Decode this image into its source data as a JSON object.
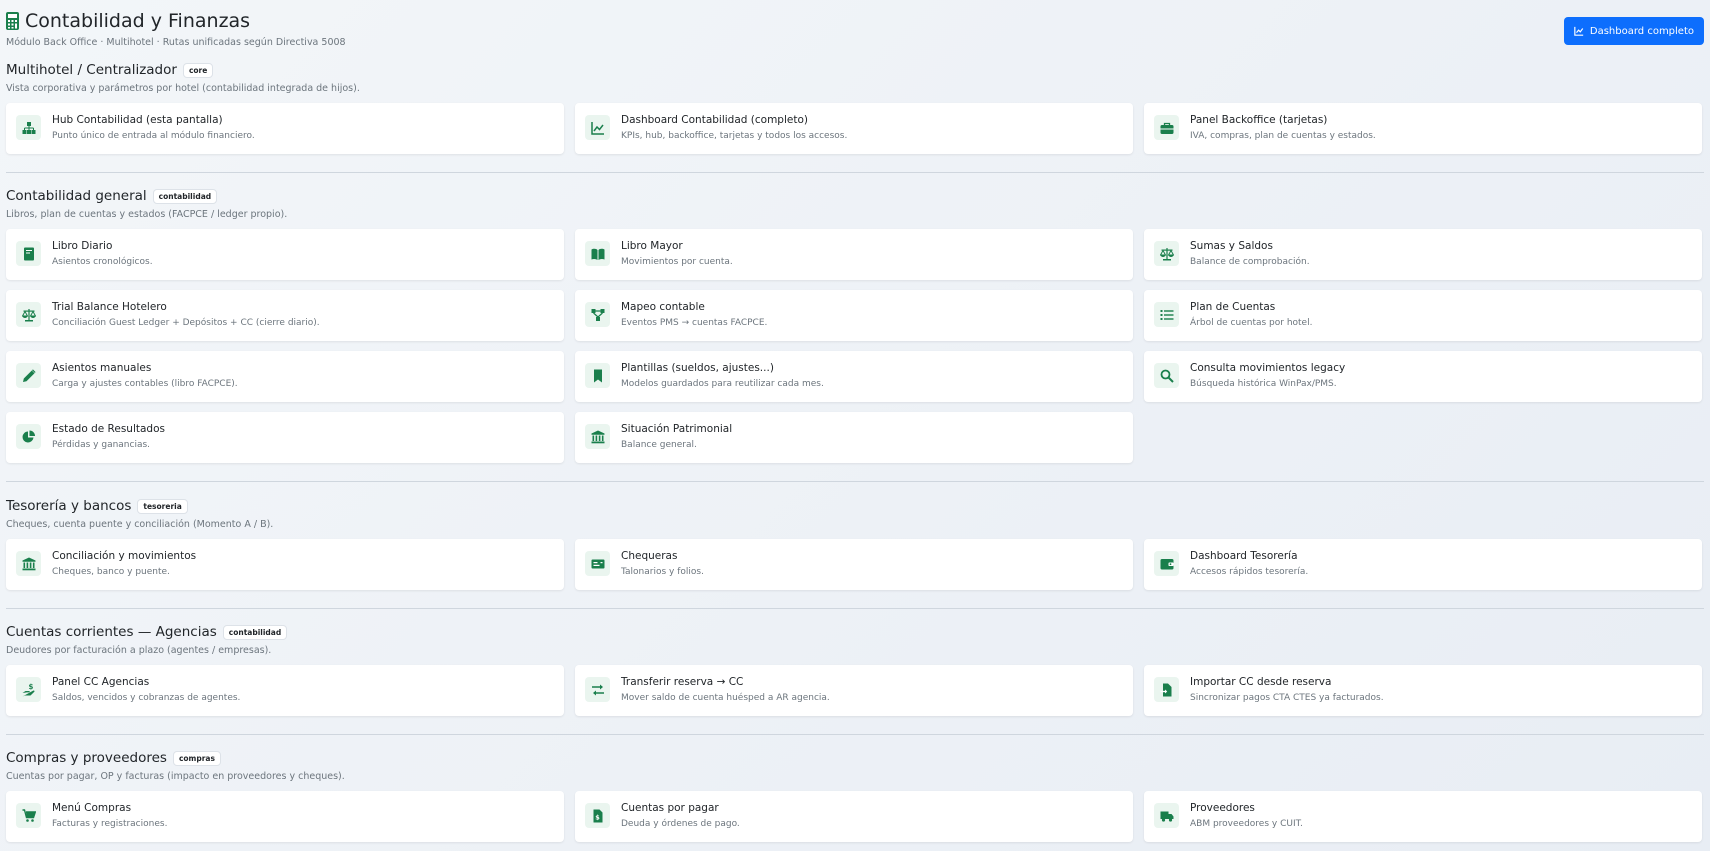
{
  "header": {
    "title": "Contabilidad y Finanzas",
    "subtitle": "Módulo Back Office · Multihotel · Rutas unificadas según Directiva 5008",
    "dashboard_button": "Dashboard completo"
  },
  "sections": [
    {
      "title": "Multihotel / Centralizador",
      "badge": "core",
      "desc": "Vista corporativa y parámetros por hotel (contabilidad integrada de hijos).",
      "cards": [
        {
          "title": "Hub Contabilidad (esta pantalla)",
          "desc": "Punto único de entrada al módulo financiero.",
          "icon": "sitemap-icon"
        },
        {
          "title": "Dashboard Contabilidad (completo)",
          "desc": "KPIs, hub, backoffice, tarjetas y todos los accesos.",
          "icon": "chart-line-icon"
        },
        {
          "title": "Panel Backoffice (tarjetas)",
          "desc": "IVA, compras, plan de cuentas y estados.",
          "icon": "briefcase-icon"
        }
      ]
    },
    {
      "title": "Contabilidad general",
      "badge": "contabilidad",
      "desc": "Libros, plan de cuentas y estados (FACPCE / ledger propio).",
      "cards": [
        {
          "title": "Libro Diario",
          "desc": "Asientos cronológicos.",
          "icon": "book-icon"
        },
        {
          "title": "Libro Mayor",
          "desc": "Movimientos por cuenta.",
          "icon": "book-open-icon"
        },
        {
          "title": "Sumas y Saldos",
          "desc": "Balance de comprobación.",
          "icon": "scale-icon"
        },
        {
          "title": "Trial Balance Hotelero",
          "desc": "Conciliación Guest Ledger + Depósitos + CC (cierre diario).",
          "icon": "scale-icon"
        },
        {
          "title": "Mapeo contable",
          "desc": "Eventos PMS → cuentas FACPCE.",
          "icon": "diagram-icon"
        },
        {
          "title": "Plan de Cuentas",
          "desc": "Árbol de cuentas por hotel.",
          "icon": "list-icon"
        },
        {
          "title": "Asientos manuales",
          "desc": "Carga y ajustes contables (libro FACPCE).",
          "icon": "pencil-icon"
        },
        {
          "title": "Plantillas (sueldos, ajustes...)",
          "desc": "Modelos guardados para reutilizar cada mes.",
          "icon": "bookmark-icon"
        },
        {
          "title": "Consulta movimientos legacy",
          "desc": "Búsqueda histórica WinPax/PMS.",
          "icon": "search-icon"
        },
        {
          "title": "Estado de Resultados",
          "desc": "Pérdidas y ganancias.",
          "icon": "pie-chart-icon"
        },
        {
          "title": "Situación Patrimonial",
          "desc": "Balance general.",
          "icon": "bank-icon"
        }
      ]
    },
    {
      "title": "Tesorería y bancos",
      "badge": "tesoreria",
      "desc": "Cheques, cuenta puente y conciliación (Momento A / B).",
      "cards": [
        {
          "title": "Conciliación y movimientos",
          "desc": "Cheques, banco y puente.",
          "icon": "bank-icon"
        },
        {
          "title": "Chequeras",
          "desc": "Talonarios y folios.",
          "icon": "money-check-icon"
        },
        {
          "title": "Dashboard Tesorería",
          "desc": "Accesos rápidos tesorería.",
          "icon": "wallet-icon"
        }
      ]
    },
    {
      "title": "Cuentas corrientes — Agencias",
      "badge": "contabilidad",
      "desc": "Deudores por facturación a plazo (agentes / empresas).",
      "cards": [
        {
          "title": "Panel CC Agencias",
          "desc": "Saldos, vencidos y cobranzas de agentes.",
          "icon": "hand-dollar-icon"
        },
        {
          "title": "Transferir reserva → CC",
          "desc": "Mover saldo de cuenta huésped a AR agencia.",
          "icon": "exchange-icon"
        },
        {
          "title": "Importar CC desde reserva",
          "desc": "Sincronizar pagos CTA CTES ya facturados.",
          "icon": "file-import-icon"
        }
      ]
    },
    {
      "title": "Compras y proveedores",
      "badge": "compras",
      "desc": "Cuentas por pagar, OP y facturas (impacto en proveedores y cheques).",
      "cards": [
        {
          "title": "Menú Compras",
          "desc": "Facturas y registraciones.",
          "icon": "cart-icon"
        },
        {
          "title": "Cuentas por pagar",
          "desc": "Deuda y órdenes de pago.",
          "icon": "file-invoice-icon"
        },
        {
          "title": "Proveedores",
          "desc": "ABM proveedores y CUIT.",
          "icon": "truck-icon"
        }
      ]
    }
  ]
}
